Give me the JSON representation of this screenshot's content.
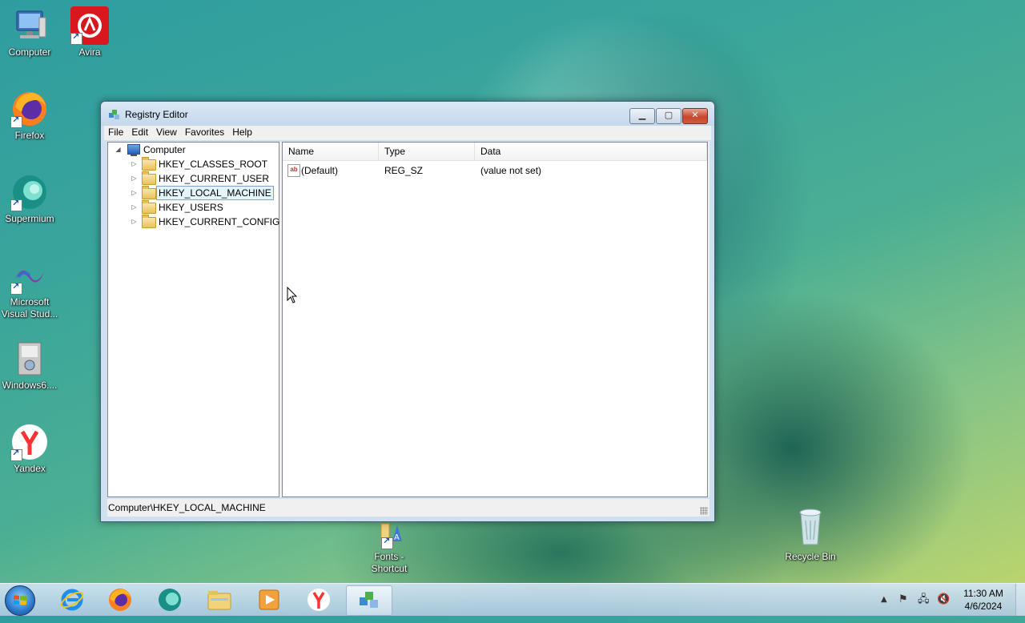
{
  "desktop": {
    "icons": [
      {
        "label": "Computer",
        "icon": "computer-icon"
      },
      {
        "label": "Avira",
        "icon": "avira-icon"
      },
      {
        "label": "Firefox",
        "icon": "firefox-icon"
      },
      {
        "label": "Supermium",
        "icon": "supermium-icon"
      },
      {
        "label": "Microsoft\nVisual Stud...",
        "icon": "visual-studio-icon"
      },
      {
        "label": "Windows6....",
        "icon": "installer-icon"
      },
      {
        "label": "Yandex",
        "icon": "yandex-icon"
      },
      {
        "label": "Fonts -\nShortcut",
        "icon": "fonts-folder-icon"
      },
      {
        "label": "Recycle Bin",
        "icon": "recycle-bin-icon"
      }
    ]
  },
  "window": {
    "title": "Registry Editor",
    "menu": [
      "File",
      "Edit",
      "View",
      "Favorites",
      "Help"
    ],
    "tree": {
      "root": "Computer",
      "children": [
        "HKEY_CLASSES_ROOT",
        "HKEY_CURRENT_USER",
        "HKEY_LOCAL_MACHINE",
        "HKEY_USERS",
        "HKEY_CURRENT_CONFIG"
      ],
      "selected": "HKEY_LOCAL_MACHINE"
    },
    "list": {
      "columns": [
        "Name",
        "Type",
        "Data"
      ],
      "rows": [
        {
          "name": "(Default)",
          "type": "REG_SZ",
          "data": "(value not set)"
        }
      ]
    },
    "status": "Computer\\HKEY_LOCAL_MACHINE"
  },
  "taskbar": {
    "apps": [
      "internet-explorer-icon",
      "firefox-icon",
      "supermium-icon",
      "file-explorer-icon",
      "media-player-icon",
      "yandex-icon",
      "registry-editor-icon"
    ],
    "active_app": "registry-editor-icon",
    "clock_time": "11:30 AM",
    "clock_date": "4/6/2024"
  },
  "colors": {
    "accent": "#2c77c9",
    "close_button": "#c8462b",
    "selection": "#e5f3fb"
  }
}
